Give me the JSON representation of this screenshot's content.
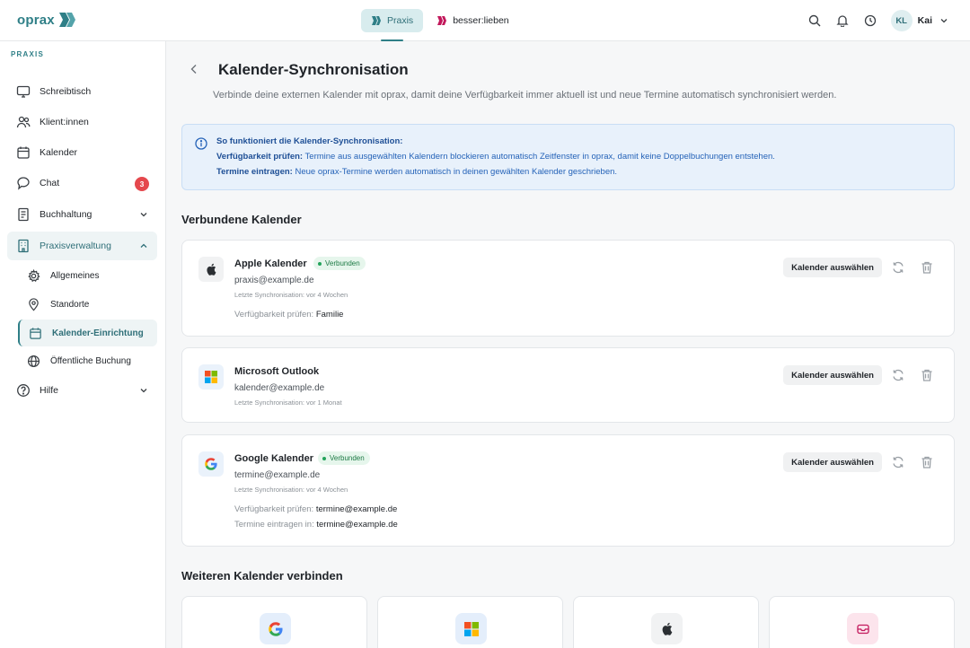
{
  "brand": {
    "name": "oprax",
    "accent": "#2f7f87"
  },
  "top_tabs": [
    {
      "label": "Praxis",
      "active": true
    },
    {
      "label": "besser:lieben",
      "active": false
    }
  ],
  "user": {
    "initials": "KL",
    "name": "Kai"
  },
  "sidebar": {
    "heading": "PRAXIS",
    "items": [
      {
        "label": "Schreibtisch",
        "icon": "monitor-icon"
      },
      {
        "label": "Klient:innen",
        "icon": "users-icon"
      },
      {
        "label": "Kalender",
        "icon": "calendar-icon"
      },
      {
        "label": "Chat",
        "icon": "chat-icon",
        "badge": "3"
      },
      {
        "label": "Buchhaltung",
        "icon": "receipt-icon"
      },
      {
        "label": "Praxisverwaltung",
        "icon": "building-icon"
      },
      {
        "label": "Hilfe",
        "icon": "help-icon"
      }
    ],
    "subitems": [
      {
        "label": "Allgemeines",
        "icon": "gear-icon"
      },
      {
        "label": "Standorte",
        "icon": "location-icon"
      },
      {
        "label": "Kalender-Einrichtung",
        "icon": "calendar-icon",
        "active": true
      },
      {
        "label": "Öffentliche Buchung",
        "icon": "globe-icon"
      }
    ]
  },
  "page": {
    "title": "Kalender-Synchronisation",
    "subtitle": "Verbinde deine externen Kalender mit oprax, damit deine Verfügbarkeit immer aktuell ist und neue Termine automatisch synchronisiert werden."
  },
  "info": {
    "title": "So funktioniert die Kalender-Synchronisation:",
    "line1_bold": "Verfügbarkeit prüfen:",
    "line1_text": " Termine aus ausgewählten Kalendern blockieren automatisch Zeitfenster in oprax, damit keine Doppelbuchungen entstehen.",
    "line2_bold": "Termine eintragen:",
    "line2_text": " Neue oprax-Termine werden automatisch in deinen gewählten Kalender geschrieben."
  },
  "connected_title": "Verbundene Kalender",
  "select_label": "Kalender auswählen",
  "connected_badge": "Verbunden",
  "calendars": [
    {
      "name": "Apple Kalender",
      "email": "praxis@example.de",
      "sync": "Letzte Synchronisation: vor 4 Wochen",
      "check_label": "Verfügbarkeit prüfen:",
      "check_value": "Familie"
    },
    {
      "name": "Microsoft Outlook",
      "email": "kalender@example.de",
      "sync": "Letzte Synchronisation: vor 1 Monat"
    },
    {
      "name": "Google Kalender",
      "email": "termine@example.de",
      "sync": "Letzte Synchronisation: vor 4 Wochen",
      "check_label": "Verfügbarkeit prüfen:",
      "check_value": "termine@example.de",
      "write_label": "Termine eintragen in:",
      "write_value": "termine@example.de"
    }
  ],
  "more_title": "Weiteren Kalender verbinden",
  "providers": [
    "google-icon",
    "microsoft-icon",
    "apple-icon",
    "inbox-icon"
  ]
}
